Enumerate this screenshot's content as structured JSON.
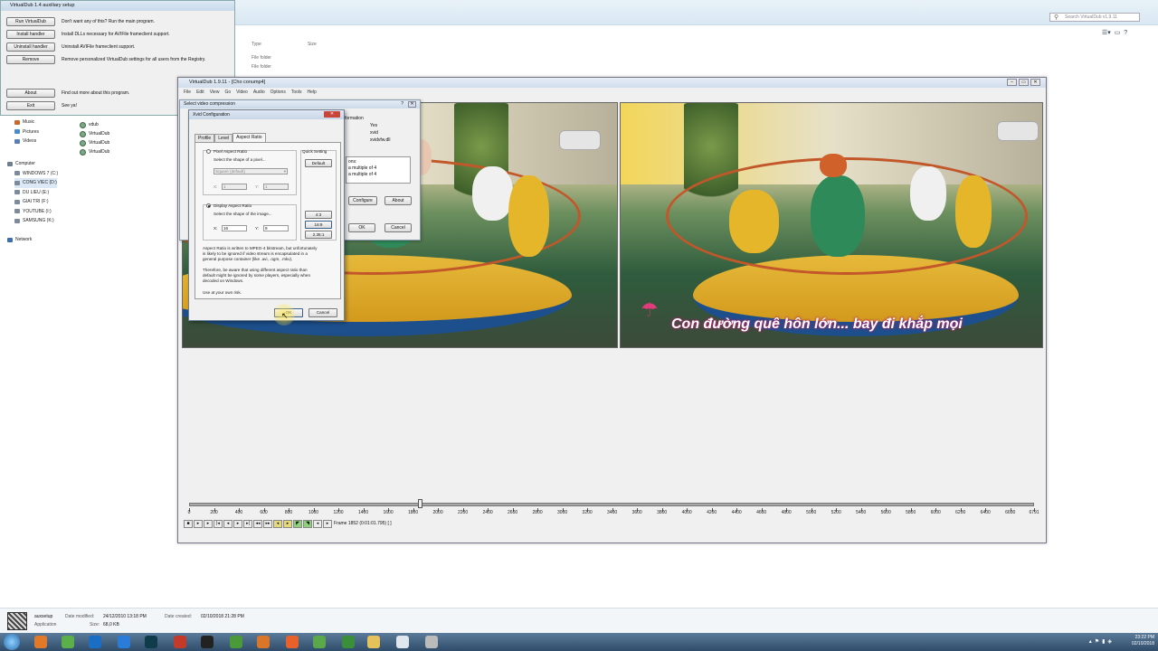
{
  "explorer": {
    "search_placeholder": "Search VirtualDub v1.9.11",
    "columns": {
      "type": "Type",
      "size": "Size"
    },
    "folder_type": "File folder",
    "nav": [
      {
        "label": "Music",
        "color": "#c56a2d"
      },
      {
        "label": "Pictures",
        "color": "#4b8bc7"
      },
      {
        "label": "Videos",
        "color": "#5a7fb5"
      },
      {
        "label": "Computer",
        "color": "#6f7f90"
      },
      {
        "label": "WINDOWS 7 (C:)",
        "color": "#7c8a99"
      },
      {
        "label": "CONG VIEC (D:)",
        "color": "#7c8a99"
      },
      {
        "label": "DU LIEU (E:)",
        "color": "#7c8a99"
      },
      {
        "label": "GIAI TRI (F:)",
        "color": "#7c8a99"
      },
      {
        "label": "YOUTUBE (I:)",
        "color": "#7c8a99"
      },
      {
        "label": "SAMSUNG (K:)",
        "color": "#7c8a99"
      },
      {
        "label": "Network",
        "color": "#3f6fa8"
      }
    ],
    "files": [
      "vdub",
      "VirtualDub",
      "VirtualDub",
      "VirtualDub"
    ]
  },
  "aux": {
    "title": "VirtualDub 1.4 auxiliary setup",
    "rows": [
      {
        "button": "Run VirtualDub",
        "desc": "Don't want any of this? Run the main program."
      },
      {
        "button": "Install handler",
        "desc": "Install DLLs necessary for AVIFile frameclient support."
      },
      {
        "button": "Uninstall handler",
        "desc": "Uninstall AVIFile frameclient support."
      },
      {
        "button": "Remove",
        "desc": "Remove personalized VirtualDub settings for all users from the Registry."
      },
      {
        "button": "About",
        "desc": "Find out more about this program."
      },
      {
        "button": "Exit",
        "desc": "See ya!"
      }
    ]
  },
  "vdub": {
    "title": "VirtualDub 1.9.11 - [Cho conump4]",
    "menu": [
      "File",
      "Edit",
      "View",
      "Go",
      "Video",
      "Audio",
      "Options",
      "Tools",
      "Help"
    ],
    "caption": "Con đường quê hôn lớn... bay đi khắp mọi",
    "timeline": {
      "labels": [
        "0",
        "200",
        "400",
        "600",
        "800",
        "1000",
        "1200",
        "1400",
        "1600",
        "1800",
        "2000",
        "2200",
        "2400",
        "2600",
        "2800",
        "3000",
        "3200",
        "3400",
        "3600",
        "3800",
        "4000",
        "4200",
        "4400",
        "4600",
        "4800",
        "5000",
        "5200",
        "5400",
        "5600",
        "5800",
        "6000",
        "6200",
        "6400",
        "6600",
        "6791"
      ],
      "total_frames": 6791,
      "current_frame": 1852
    },
    "frame_status": "Frame 1852 (0:01:01.795) [ ]"
  },
  "svc": {
    "title": "Select video compression",
    "info_header": "formation",
    "info_lines": [
      "Yes",
      "xvid",
      "xvidvfw.dll"
    ],
    "codec_lines": [
      "ons:",
      "a multiple of 4",
      "a multiple of 4"
    ],
    "configure": "Configure",
    "about": "About",
    "ok": "OK",
    "cancel": "Cancel"
  },
  "xvid": {
    "title": "Xvid Configuration",
    "tabs": [
      "Profile",
      "Level",
      "Aspect Ratio"
    ],
    "pixel_ar": "Pixel Aspect Ratio",
    "pixel_hint": "Select the shape of a pixel...",
    "pixel_shape": "Square (default)",
    "x_label": "X:",
    "y_label": "Y:",
    "pixel_x": "1",
    "pixel_y": "1",
    "quick_setting": "Quick Setting",
    "default_btn": "Default",
    "display_ar": "Display Aspect Ratio",
    "display_hint": "Select the shape of the image...",
    "display_x": "16",
    "display_y": "9",
    "ar_buttons": [
      "4:3",
      "16:9",
      "2.35:1"
    ],
    "note1": [
      "Aspect Ratio is written to MPEG-4 bitstream, but unfortunately",
      "is likely to be ignored if video stream is encapsulated in a",
      "general purpose container (like .avi, .ogm, .mkv)."
    ],
    "note2": [
      "Therefore, be aware that using different aspect ratio than",
      "default might be ignored by some players, especially when",
      "decoded on Windows."
    ],
    "note3": "Use at your own risk.",
    "ok": "OK",
    "cancel": "Cancel"
  },
  "details": {
    "name": "auxsetup",
    "kind": "Application",
    "modified_label": "Date modified:",
    "modified": "24/12/2010 13:18 PM",
    "size_label": "Size:",
    "size": "68,0 KB",
    "created_label": "Date created:",
    "created": "02/10/2018 21:28 PM"
  },
  "taskbar": {
    "time": "23:22 PM",
    "date": "02/10/2018",
    "icons": [
      {
        "name": "paint-icon",
        "color": "#e07a2a"
      },
      {
        "name": "utorrent-icon",
        "color": "#5bb04a"
      },
      {
        "name": "teamviewer-icon",
        "color": "#1a6fc4"
      },
      {
        "name": "app-blue-icon",
        "color": "#2a7cd8"
      },
      {
        "name": "audition-icon",
        "color": "#0f3b4a"
      },
      {
        "name": "media-icon",
        "color": "#c43a2a"
      },
      {
        "name": "record-icon",
        "color": "#222222"
      },
      {
        "name": "camtasia-icon",
        "color": "#4a9a3a"
      },
      {
        "name": "tool-icon",
        "color": "#d9762a"
      },
      {
        "name": "firefox-icon",
        "color": "#e8602a"
      },
      {
        "name": "evernote-icon",
        "color": "#5aa84a"
      },
      {
        "name": "chrome-icon",
        "color": "#3b8e3a"
      },
      {
        "name": "folder-icon",
        "color": "#e6c25a"
      },
      {
        "name": "window-icon",
        "color": "#dfe6ee"
      },
      {
        "name": "virtualdub-icon",
        "color": "#bbbbbb"
      }
    ]
  }
}
